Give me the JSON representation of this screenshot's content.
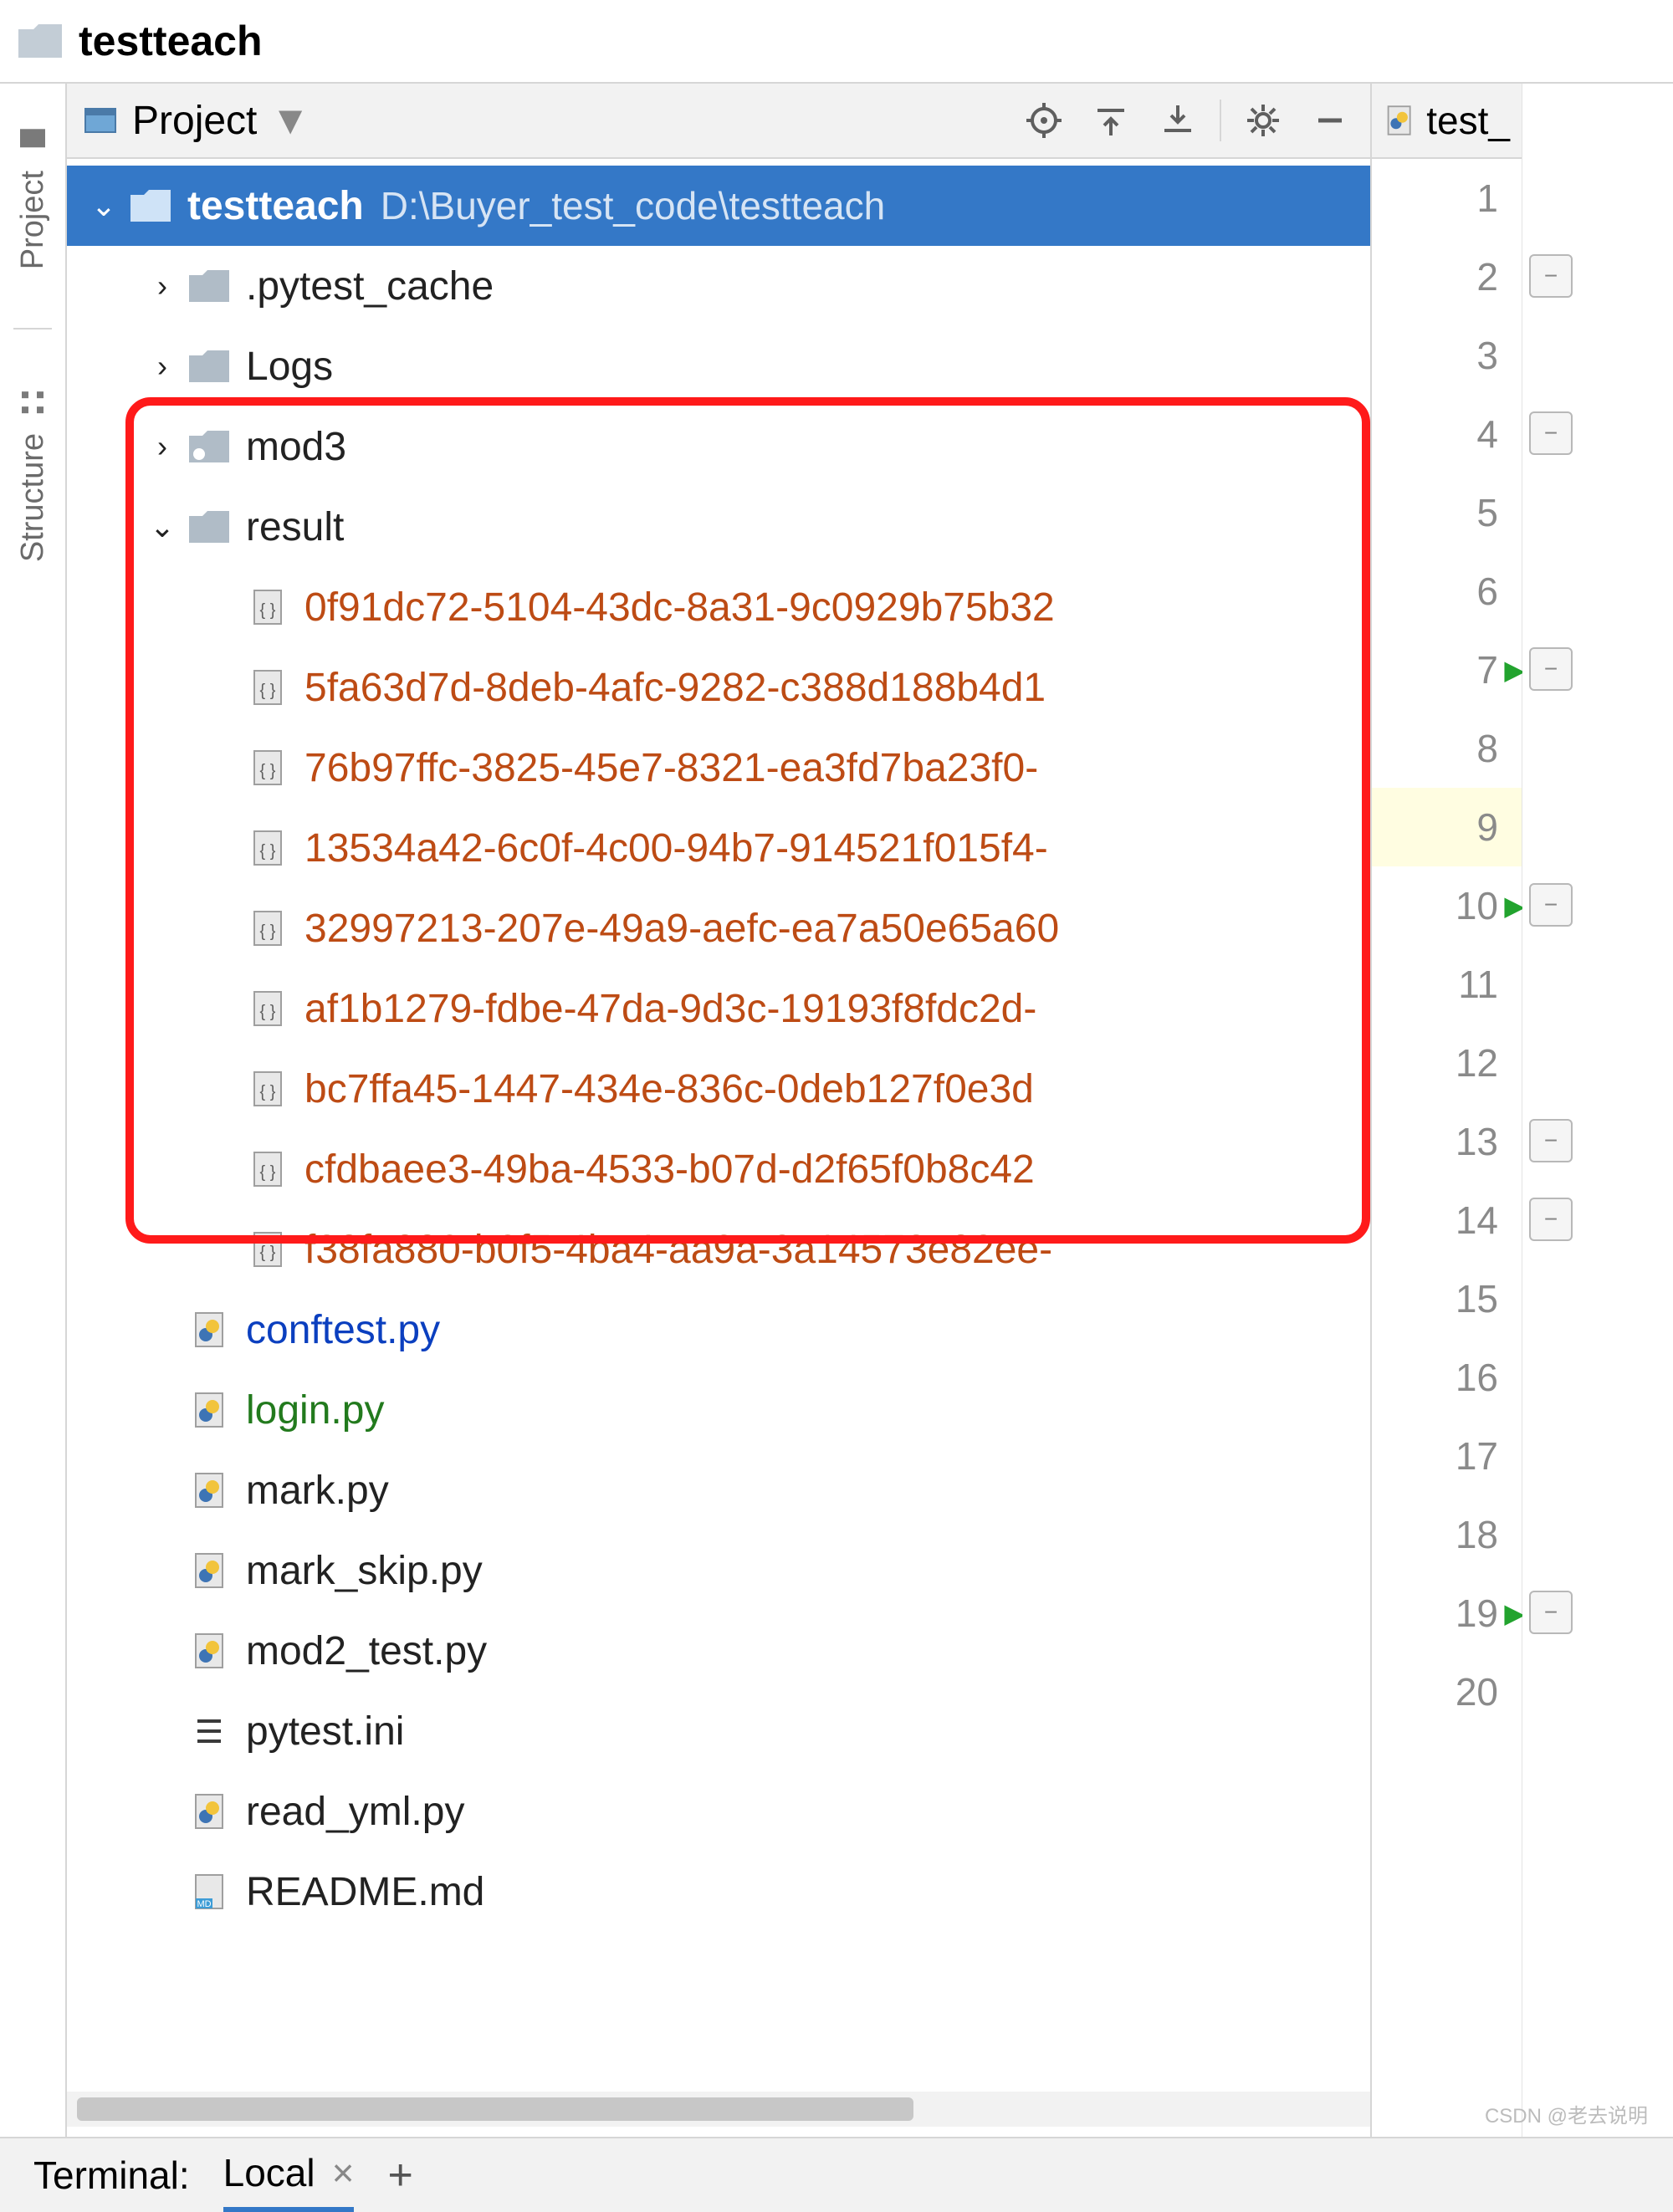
{
  "breadcrumb": {
    "project": "testteach"
  },
  "sidebar": {
    "tabs": [
      {
        "label": "Project"
      },
      {
        "label": "Structure"
      }
    ]
  },
  "project_panel": {
    "title": "Project",
    "root": {
      "name": "testteach",
      "path": "D:\\Buyer_test_code\\testteach"
    },
    "folders": [
      {
        "name": ".pytest_cache",
        "expanded": false
      },
      {
        "name": "Logs",
        "expanded": false
      },
      {
        "name": "mod3",
        "expanded": false,
        "marker": true
      },
      {
        "name": "result",
        "expanded": true
      }
    ],
    "result_files": [
      "0f91dc72-5104-43dc-8a31-9c0929b75b32",
      "5fa63d7d-8deb-4afc-9282-c388d188b4d1",
      "76b97ffc-3825-45e7-8321-ea3fd7ba23f0-",
      "13534a42-6c0f-4c00-94b7-914521f015f4-",
      "32997213-207e-49a9-aefc-ea7a50e65a60",
      "af1b1279-fdbe-47da-9d3c-19193f8fdc2d-",
      "bc7ffa45-1447-434e-836c-0deb127f0e3d",
      "cfdbaee3-49ba-4533-b07d-d2f65f0b8c42",
      "f38fa880-b0f5-4ba4-aa9a-3a14573e82ee-"
    ],
    "files": [
      {
        "name": "conftest.py",
        "style": "blue",
        "type": "py"
      },
      {
        "name": "login.py",
        "style": "green",
        "type": "py"
      },
      {
        "name": "mark.py",
        "style": "normal",
        "type": "py"
      },
      {
        "name": "mark_skip.py",
        "style": "normal",
        "type": "py"
      },
      {
        "name": "mod2_test.py",
        "style": "normal",
        "type": "py"
      },
      {
        "name": "pytest.ini",
        "style": "normal",
        "type": "ini"
      },
      {
        "name": "read_yml.py",
        "style": "normal",
        "type": "py"
      },
      {
        "name": "README.md",
        "style": "normal",
        "type": "md"
      }
    ]
  },
  "editor": {
    "tab_label": "test_",
    "line_count": 20,
    "current_line": 9,
    "run_markers": [
      7,
      10,
      19
    ],
    "fold_markers": [
      2,
      4,
      7,
      10,
      13,
      14,
      19
    ]
  },
  "terminal": {
    "label": "Terminal:",
    "tabs": [
      {
        "name": "Local",
        "active": true
      }
    ],
    "add_label": "+"
  },
  "watermark": "CSDN @老去说明"
}
